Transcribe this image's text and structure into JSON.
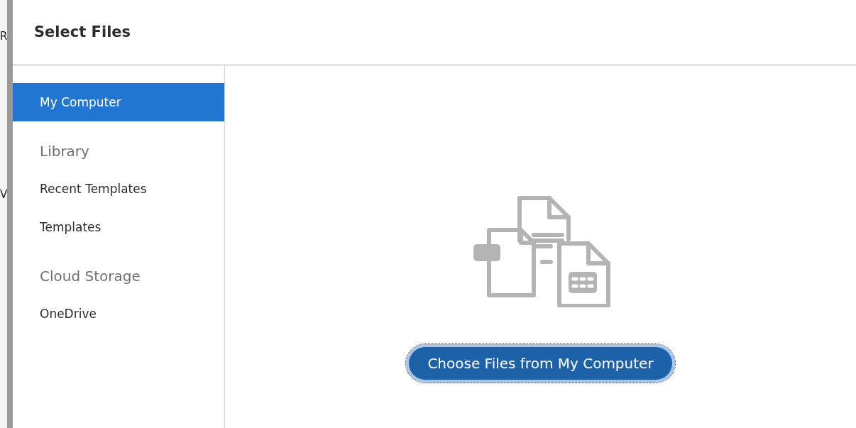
{
  "background_fragments": [
    "R",
    "V"
  ],
  "dialog": {
    "title": "Select Files"
  },
  "sidebar": {
    "items": [
      {
        "kind": "item",
        "label": "My Computer",
        "selected": true
      },
      {
        "kind": "header",
        "label": "Library"
      },
      {
        "kind": "item",
        "label": "Recent Templates",
        "selected": false
      },
      {
        "kind": "item",
        "label": "Templates",
        "selected": false
      },
      {
        "kind": "header",
        "label": "Cloud Storage"
      },
      {
        "kind": "item",
        "label": "OneDrive",
        "selected": false
      }
    ]
  },
  "content": {
    "button": {
      "label": "Choose Files from My Computer",
      "focused": true
    }
  }
}
